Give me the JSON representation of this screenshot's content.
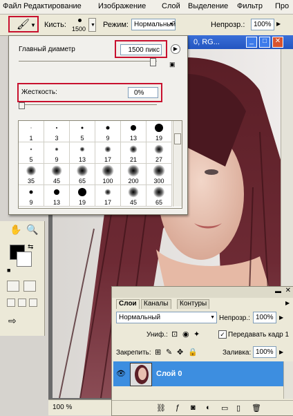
{
  "menu": {
    "items": [
      "Файл",
      "Редактирование",
      "Изображение",
      "Слой",
      "Выделение",
      "Фильтр",
      "Про"
    ]
  },
  "options": {
    "brush_label": "Кисть:",
    "brush_size": "1500",
    "mode_label": "Режим:",
    "mode_value": "Нормальный",
    "opacity_label": "Непрозр.:",
    "opacity_value": "100%"
  },
  "doc": {
    "title_fragment": "0, RG...",
    "zoom": "100 %"
  },
  "brush_panel": {
    "diameter_label": "Главный диаметр",
    "diameter_value": "1500 пикс",
    "hardness_label": "Жесткость:",
    "hardness_value": "0%",
    "presets": [
      {
        "label": "1",
        "d": 1,
        "soft": false
      },
      {
        "label": "3",
        "d": 2,
        "soft": false
      },
      {
        "label": "5",
        "d": 3,
        "soft": false
      },
      {
        "label": "9",
        "d": 5,
        "soft": false
      },
      {
        "label": "13",
        "d": 8,
        "soft": false
      },
      {
        "label": "19",
        "d": 12,
        "soft": false
      },
      {
        "label": "5",
        "d": 3,
        "soft": true
      },
      {
        "label": "9",
        "d": 5,
        "soft": true
      },
      {
        "label": "13",
        "d": 7,
        "soft": true
      },
      {
        "label": "17",
        "d": 9,
        "soft": true
      },
      {
        "label": "21",
        "d": 11,
        "soft": true
      },
      {
        "label": "27",
        "d": 13,
        "soft": true
      },
      {
        "label": "35",
        "d": 14,
        "soft": true
      },
      {
        "label": "45",
        "d": 15,
        "soft": true
      },
      {
        "label": "65",
        "d": 16,
        "soft": true
      },
      {
        "label": "100",
        "d": 17,
        "soft": true
      },
      {
        "label": "200",
        "d": 17,
        "soft": true
      },
      {
        "label": "300",
        "d": 17,
        "soft": true
      },
      {
        "label": "9",
        "d": 5,
        "soft": false
      },
      {
        "label": "13",
        "d": 8,
        "soft": false
      },
      {
        "label": "19",
        "d": 12,
        "soft": false
      },
      {
        "label": "17",
        "d": 9,
        "soft": true
      },
      {
        "label": "45",
        "d": 15,
        "soft": true
      },
      {
        "label": "65",
        "d": 16,
        "soft": true
      }
    ]
  },
  "layers": {
    "tabs": [
      "Слои",
      "Каналы",
      "Контуры"
    ],
    "blend_mode": "Нормальный",
    "opacity_label": "Непрозр.:",
    "opacity_value": "100%",
    "unify_label": "Униф.:",
    "propagate_label": "Передавать кадр 1",
    "lock_label": "Закрепить:",
    "fill_label": "Заливка:",
    "fill_value": "100%",
    "layer_name": "Слой 0",
    "selected_color": "#3d8ee0"
  },
  "colors": {
    "highlight": "#c8102e"
  }
}
